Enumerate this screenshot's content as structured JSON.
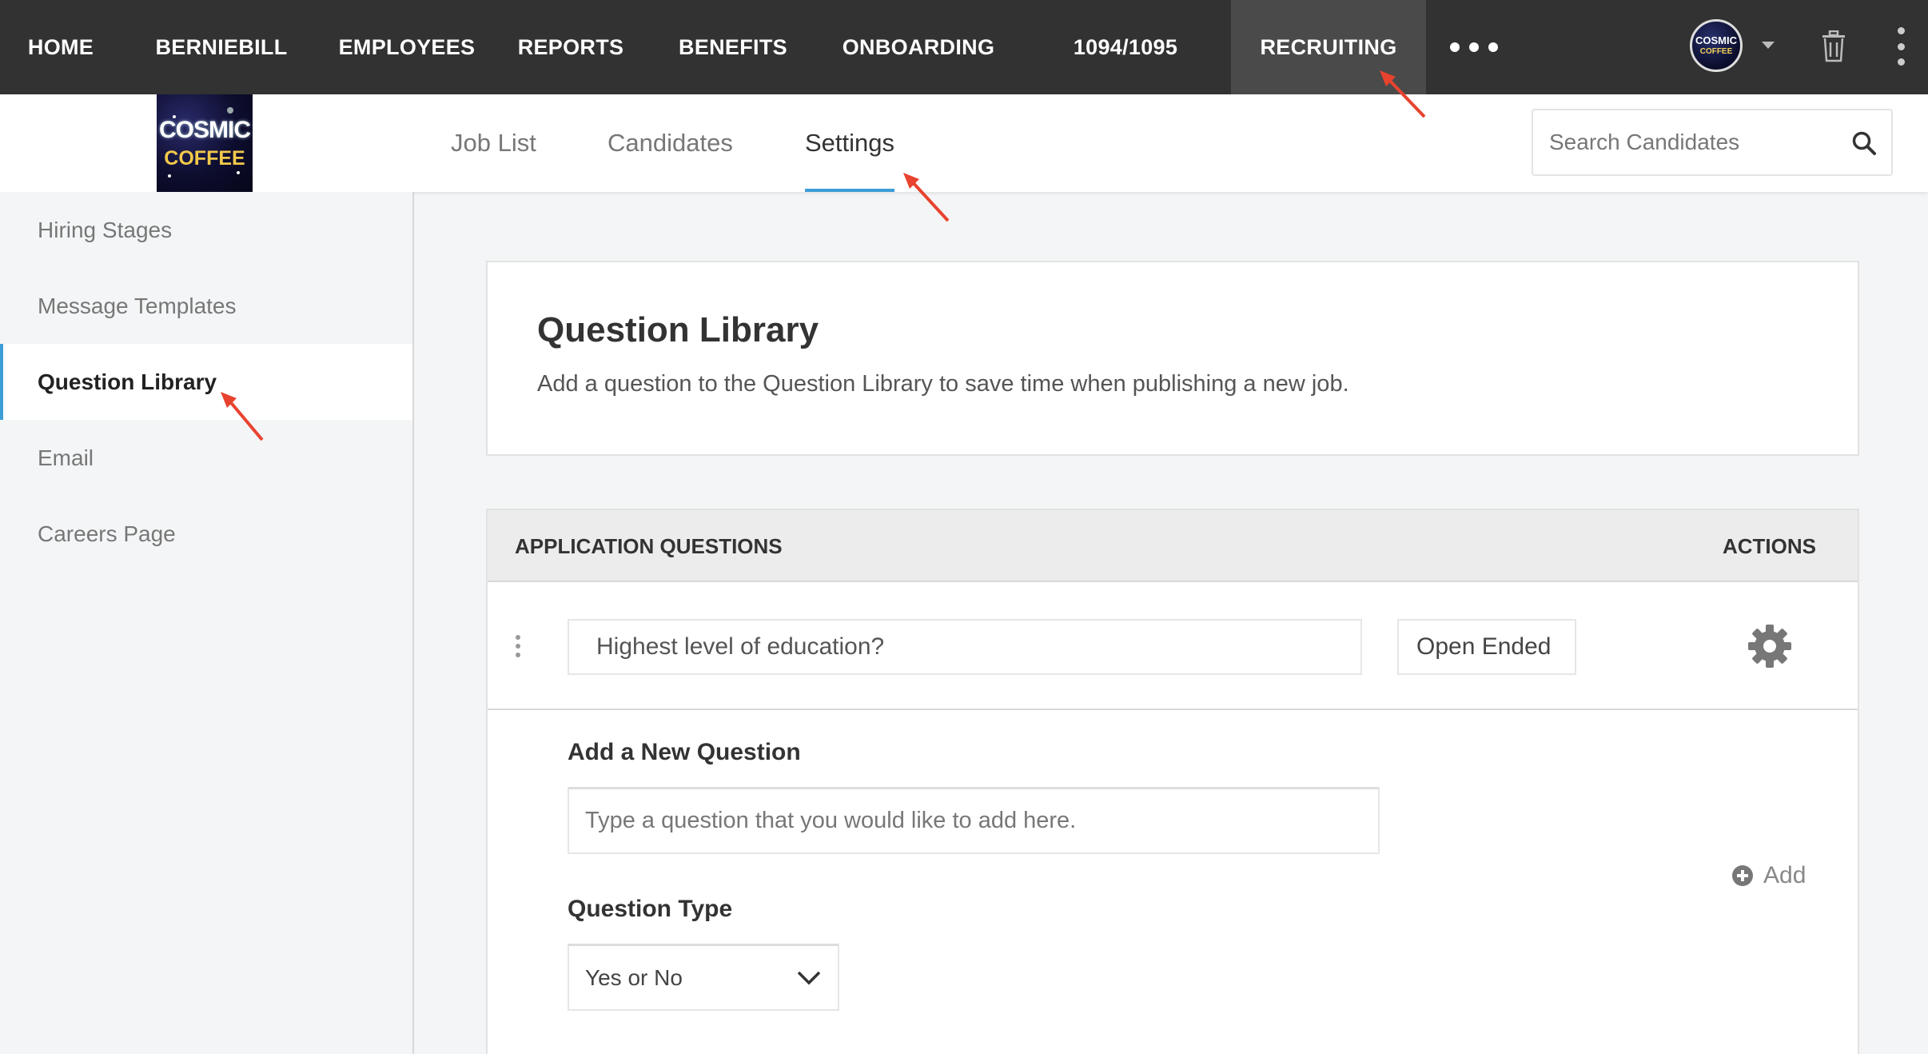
{
  "topnav": {
    "items": [
      {
        "label": "HOME"
      },
      {
        "label": "BERNIEBILL"
      },
      {
        "label": "EMPLOYEES"
      },
      {
        "label": "REPORTS"
      },
      {
        "label": "BENEFITS"
      },
      {
        "label": "ONBOARDING"
      },
      {
        "label": "1094/1095"
      },
      {
        "label": "RECRUITING",
        "active": true
      }
    ],
    "avatar": {
      "line1": "COSMIC",
      "line2": "COFFEE"
    }
  },
  "logo": {
    "line1": "COSMIC",
    "line2": "COFFEE"
  },
  "tabs": [
    {
      "label": "Job List"
    },
    {
      "label": "Candidates"
    },
    {
      "label": "Settings",
      "active": true
    }
  ],
  "search": {
    "placeholder": "Search Candidates"
  },
  "sidebar": {
    "items": [
      {
        "label": "Hiring Stages"
      },
      {
        "label": "Message Templates"
      },
      {
        "label": "Question Library",
        "active": true
      },
      {
        "label": "Email"
      },
      {
        "label": "Careers Page"
      }
    ]
  },
  "intro": {
    "title": "Question Library",
    "description": "Add a question to the Question Library to save time when publishing a new job."
  },
  "table": {
    "header_left": "APPLICATION QUESTIONS",
    "header_right": "ACTIONS",
    "rows": [
      {
        "question": "Highest level of education?",
        "type": "Open Ended"
      }
    ]
  },
  "add_question": {
    "title": "Add a New Question",
    "input_placeholder": "Type a question that you would like to add here.",
    "type_label": "Question Type",
    "type_selected": "Yes or No",
    "add_label": "Add"
  },
  "colors": {
    "nav_bg": "#323232",
    "nav_active_bg": "#4a4a4a",
    "accent": "#3d9dd8",
    "annotation_arrow": "#e8432f"
  }
}
